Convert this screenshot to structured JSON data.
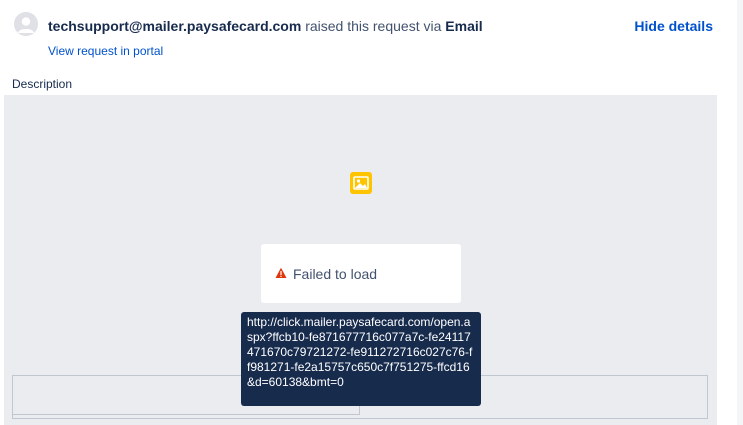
{
  "requester": {
    "email": "techsupport@mailer.paysafecard.com",
    "raised_text": "raised this request via",
    "channel": "Email",
    "portal_link": "View request in portal",
    "hide_details": "Hide details"
  },
  "description": {
    "label": "Description",
    "image_icon": "image-icon",
    "failed_text": "Failed to load",
    "warning_icon": "warning-triangle-icon",
    "tooltip_url": "http://click.mailer.paysafecard.com/open.aspx?ffcb10-fe871677716c077a7c-fe24117471670c79721272-fe911272716c027c76-ff981271-fe2a15757c650c7f751275-ffcd16&d=60138&bmt=0"
  },
  "colors": {
    "link": "#0052cc",
    "panel_bg": "#ebecf0",
    "tooltip_bg": "#172b4d",
    "image_icon": "#ffc400",
    "warning": "#de350b"
  }
}
